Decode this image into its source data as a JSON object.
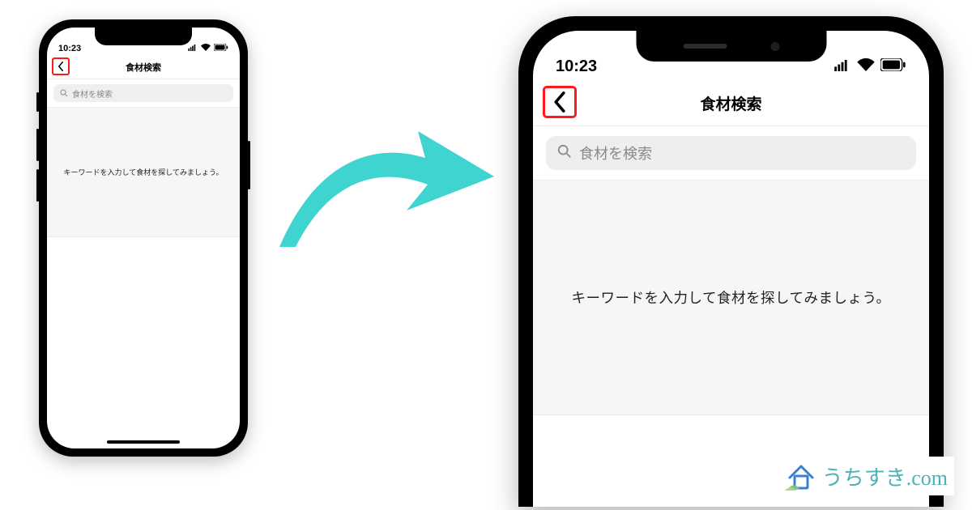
{
  "statusbar": {
    "time": "10:23"
  },
  "header": {
    "title": "食材検索"
  },
  "search": {
    "placeholder": "食材を検索"
  },
  "empty": {
    "message": "キーワードを入力して食材を探してみましょう。"
  },
  "watermark": {
    "text": "うちすき.com"
  },
  "colors": {
    "accent_arrow": "#3fd4cf",
    "highlight_border": "#ff1a1a",
    "watermark": "#4db2b8"
  }
}
